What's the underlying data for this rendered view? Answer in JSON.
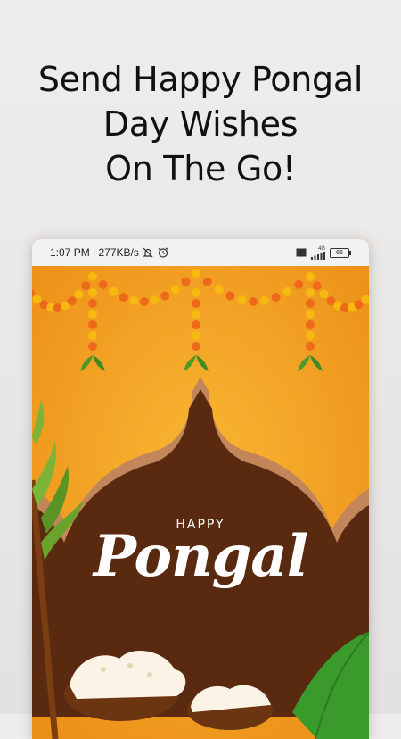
{
  "headline": {
    "line1": "Send Happy Pongal",
    "line2": "Day Wishes",
    "line3": "On The Go!"
  },
  "status_bar": {
    "time_speed": "1:07 PM | 277KB/s",
    "network": "4G",
    "volte": "Vo LTE",
    "battery": "66"
  },
  "greeting": {
    "small": "HAPPY",
    "large": "Pongal"
  },
  "icons": [
    "mute-bell-icon",
    "alarm-icon",
    "volte-icon",
    "signal-icon",
    "battery-icon"
  ],
  "colors": {
    "background": "#f3a11e",
    "frame": "#5a2a10",
    "marigold": "#f7b80f",
    "leaf": "#3a9a2c"
  }
}
